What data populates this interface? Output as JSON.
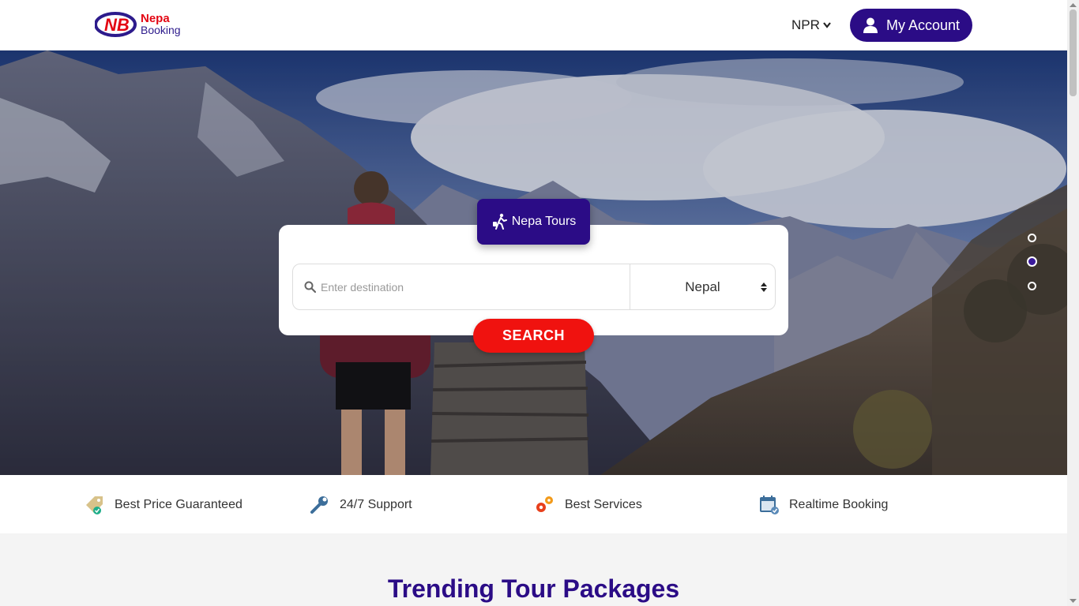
{
  "header": {
    "logo_line1": "Nepa",
    "logo_line2": "Booking",
    "logo_mark": "NB",
    "currency": "NPR",
    "account_label": "My Account"
  },
  "hero": {
    "tab_label": "Nepa Tours",
    "search_placeholder": "Enter destination",
    "country_selected": "Nepal",
    "search_button": "SEARCH",
    "slider_active_index": 1,
    "slider_count": 3
  },
  "features": [
    {
      "label": "Best Price Guaranteed",
      "icon": "price-tag-icon"
    },
    {
      "label": "24/7 Support",
      "icon": "wrench-icon"
    },
    {
      "label": "Best Services",
      "icon": "gears-icon"
    },
    {
      "label": "Realtime Booking",
      "icon": "calendar-icon"
    }
  ],
  "trending": {
    "title": "Trending Tour Packages"
  },
  "colors": {
    "brand_purple": "#2b0c86",
    "search_red": "#f0120f",
    "logo_red": "#e30613"
  }
}
